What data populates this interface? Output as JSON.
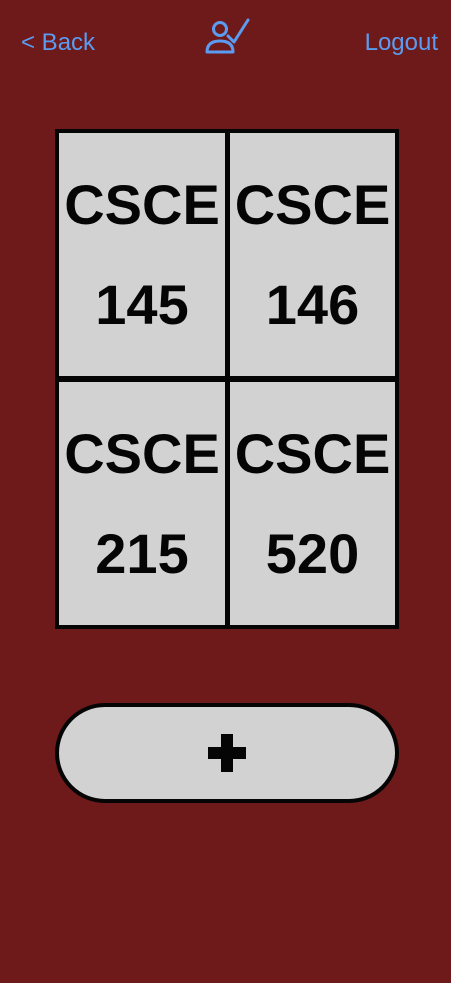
{
  "header": {
    "back_label": "< Back",
    "logout_label": "Logout",
    "profile_icon": "user-check-icon"
  },
  "courses": [
    {
      "dept": "CSCE",
      "number": "145"
    },
    {
      "dept": "CSCE",
      "number": "146"
    },
    {
      "dept": "CSCE",
      "number": "215"
    },
    {
      "dept": "CSCE",
      "number": "520"
    }
  ],
  "add_button": {
    "icon": "plus-icon"
  },
  "colors": {
    "background": "#6e1a1a",
    "link": "#5b9bf0",
    "tile": "#d2d2d2",
    "border": "#050505"
  }
}
